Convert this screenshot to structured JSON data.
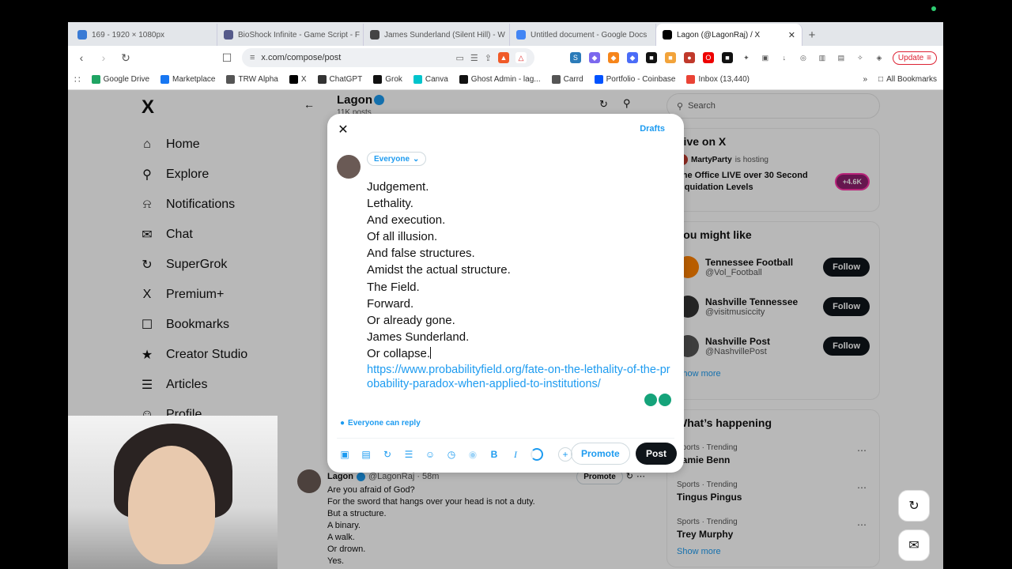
{
  "tabs": [
    {
      "title": "169 - 1920 × 1080px",
      "color": "#3a7bd5",
      "active": false
    },
    {
      "title": "BioShock Infinite - Game Script - F",
      "color": "#555a8a",
      "active": false
    },
    {
      "title": "James Sunderland (Silent Hill) - W",
      "color": "#444444",
      "active": false
    },
    {
      "title": "Untitled document - Google Docs",
      "color": "#4285f4",
      "active": false
    },
    {
      "title": "Lagon (@LagonRaj) / X",
      "color": "#000000",
      "active": true
    }
  ],
  "address": {
    "url": "x.com/compose/post",
    "update_label": "Update"
  },
  "bookmarks": {
    "items": [
      "Google Drive",
      "Marketplace",
      "TRW Alpha",
      "X",
      "ChatGPT",
      "Grok",
      "Canva",
      "Ghost Admin - lag...",
      "Carrd",
      "Portfolio - Coinbase",
      "Inbox (13,440)"
    ],
    "more": "»",
    "all": "All Bookmarks"
  },
  "nav": {
    "logo": "X",
    "items": [
      "Home",
      "Explore",
      "Notifications",
      "Chat",
      "SuperGrok",
      "Premium+",
      "Bookmarks",
      "Creator Studio",
      "Articles",
      "Profile"
    ]
  },
  "profile_header": {
    "name": "Lagon",
    "posts": "11K posts"
  },
  "right": {
    "search_placeholder": "Search",
    "live_title": "Live on X",
    "live_host": "MartyParty",
    "live_hosting": "is hosting",
    "live_desc": "The Office LIVE over 30 Second Liquidation Levels",
    "live_count": "+4.6K",
    "wtf_title": "You might like",
    "follow_label": "Follow",
    "wtf": [
      {
        "name": "Tennessee Football",
        "handle": "@Vol_Football"
      },
      {
        "name": "Nashville Tennessee",
        "handle": "@visitmusiccity"
      },
      {
        "name": "Nashville Post",
        "handle": "@NashvillePost"
      }
    ],
    "show_more": "Show more",
    "trending_title": "What’s happening",
    "trends": [
      {
        "meta": "Sports · Trending",
        "name": "Jamie Benn"
      },
      {
        "meta": "Sports · Trending",
        "name": "Tingus Pingus"
      },
      {
        "meta": "Sports · Trending",
        "name": "Trey Murphy"
      }
    ],
    "show_more_2": "Show more"
  },
  "feed_post": {
    "name": "Lagon",
    "handle": "@LagonRaj · 58m",
    "promote": "Promote",
    "lines": [
      "Are you afraid of God?",
      "For the sword that hangs over your head is not a duty.",
      "But a structure.",
      "A binary.",
      "A walk.",
      "Or drown.",
      "Yes."
    ]
  },
  "modal": {
    "drafts": "Drafts",
    "audience": "Everyone",
    "lines": [
      "Judgement.",
      "Lethality.",
      "And execution.",
      "Of all illusion.",
      "And false structures.",
      "Amidst the actual structure.",
      "The Field.",
      "Forward.",
      "Or already gone.",
      "James Sunderland.",
      "Or collapse."
    ],
    "link": "https://www.probabilityfield.org/fate-on-the-lethality-of-the-probability-paradox-when-applied-to-institutions/",
    "reply_setting": "Everyone can reply",
    "promote": "Promote",
    "post": "Post"
  }
}
